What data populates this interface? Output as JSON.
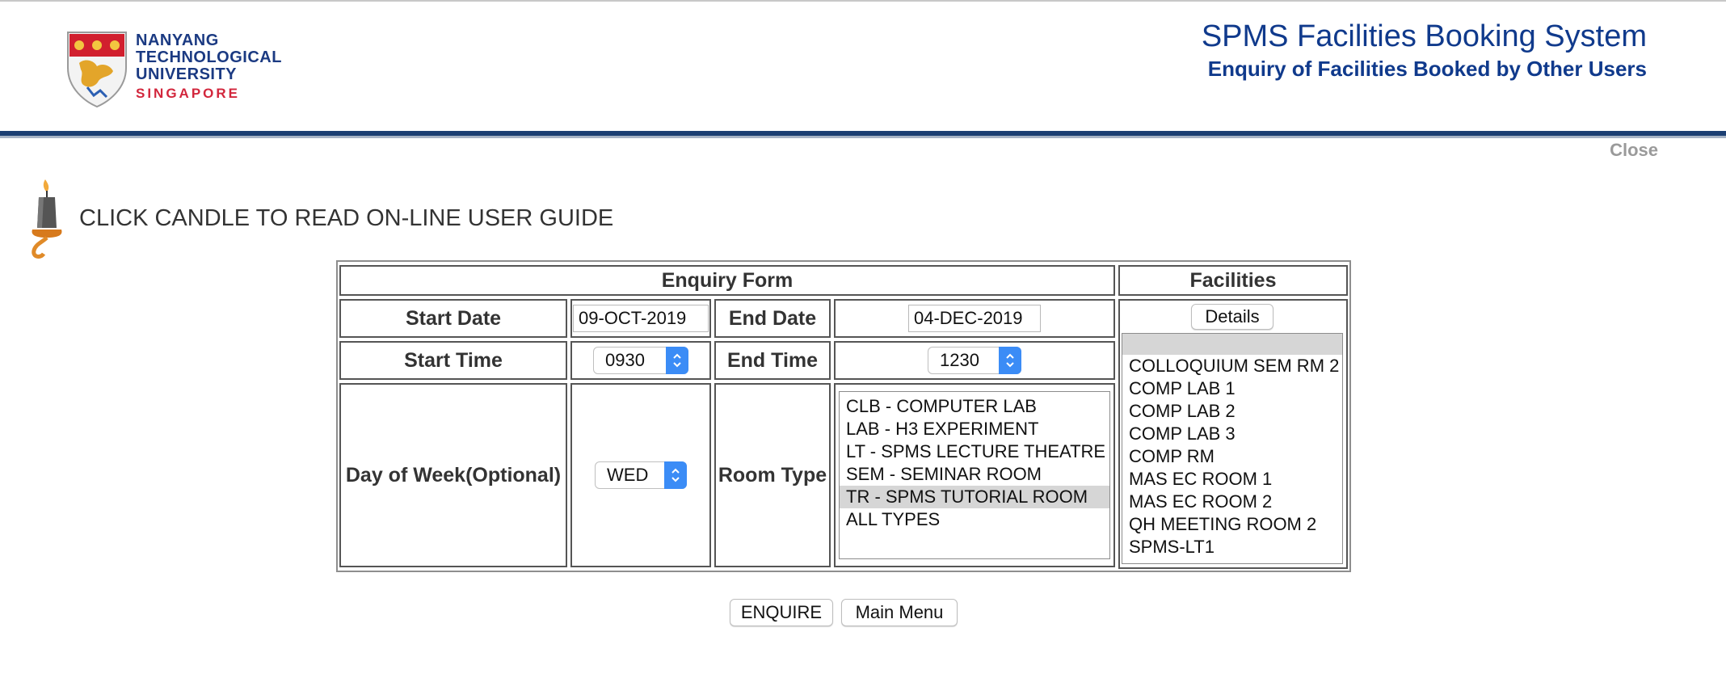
{
  "header": {
    "logo_lines": [
      "NANYANG",
      "TECHNOLOGICAL",
      "UNIVERSITY"
    ],
    "logo_sub": "SINGAPORE",
    "title": "SPMS Facilities Booking System",
    "subtitle": "Enquiry of Facilities Booked by Other Users",
    "close_label": "Close"
  },
  "guide": {
    "text": "CLICK CANDLE TO READ ON-LINE USER GUIDE",
    "icon": "candle-icon"
  },
  "form": {
    "title": "Enquiry Form",
    "start_date_label": "Start Date",
    "start_date_value": "09-OCT-2019",
    "end_date_label": "End Date",
    "end_date_value": "04-DEC-2019",
    "start_time_label": "Start Time",
    "start_time_value": "0930",
    "end_time_label": "End Time",
    "end_time_value": "1230",
    "dow_label": "Day of Week(Optional)",
    "dow_value": "WED",
    "room_type_label": "Room Type",
    "room_types": [
      "CLB - COMPUTER LAB",
      "LAB - H3 EXPERIMENT",
      "LT - SPMS LECTURE THEATRE",
      "SEM - SEMINAR ROOM",
      "TR - SPMS TUTORIAL ROOM",
      "ALL TYPES"
    ],
    "room_type_selected": "TR - SPMS TUTORIAL ROOM"
  },
  "facilities": {
    "title": "Facilities",
    "details_label": "Details",
    "items": [
      "",
      "COLLOQUIUM SEM RM 2",
      "COMP LAB 1",
      "COMP LAB 2",
      "COMP LAB 3",
      "COMP RM",
      "MAS EC ROOM 1",
      "MAS EC ROOM 2",
      "QH MEETING ROOM 2",
      "SPMS-LT1"
    ]
  },
  "actions": {
    "enquire_label": "ENQUIRE",
    "main_menu_label": "Main Menu"
  },
  "colors": {
    "brand_blue": "#103a8c",
    "rule_blue": "#1c3f73",
    "select_accent": "#3b8cf6",
    "logo_red": "#d2263c"
  }
}
